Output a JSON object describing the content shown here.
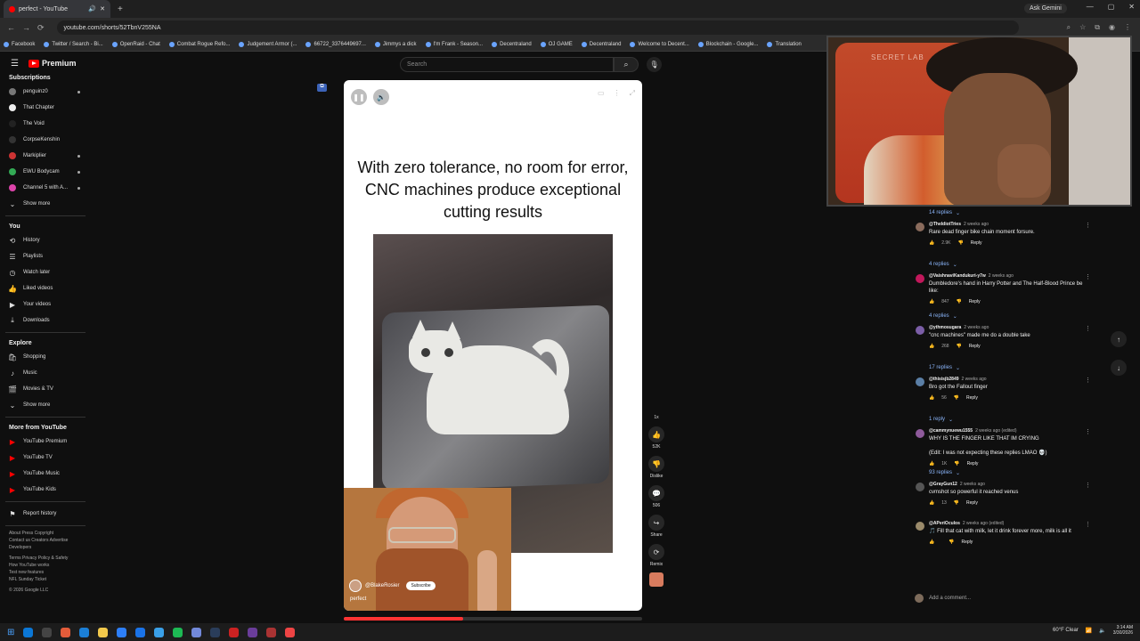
{
  "browser": {
    "tab_title": "perfect - YouTube",
    "new_tab": "+",
    "ask_gemini": "Ask Gemini",
    "url": "youtube.com/shorts/52TbnV255NA",
    "window_controls": [
      "—",
      "▢",
      "✕"
    ],
    "bookmarks": [
      "Facebook",
      "Twitter / Search - Bi...",
      "OpenRaid - Chat",
      "Combat Rogue Refo...",
      "Judgement Armor (...",
      "66722_3376449697...",
      "Jimmys a dick",
      "I'm Frank - Season...",
      "Decentraland",
      "OJ GAME",
      "Decentraland",
      "Welcome to Decent...",
      "Blockchain - Google...",
      "Translation"
    ]
  },
  "youtube": {
    "logo_text": "Premium",
    "search_placeholder": "Search"
  },
  "sidebar": {
    "subscriptions_title": "Subscriptions",
    "subscriptions": [
      {
        "label": "penguinz0",
        "color": "#777",
        "dot": true
      },
      {
        "label": "That Chapter",
        "color": "#eee",
        "dot": false
      },
      {
        "label": "The Void",
        "color": "#222",
        "dot": false
      },
      {
        "label": "CorpseKenshin",
        "color": "#333",
        "dot": false
      },
      {
        "label": "Markiplier",
        "color": "#c33",
        "dot": true
      },
      {
        "label": "EWU Bodycam",
        "color": "#3a5",
        "dot": true
      },
      {
        "label": "Channel 5 with A...",
        "color": "#d4a",
        "dot": true
      }
    ],
    "show_more_1": "Show more",
    "you_title": "You",
    "you_items": [
      {
        "label": "History",
        "icon": "⟲"
      },
      {
        "label": "Playlists",
        "icon": "☰"
      },
      {
        "label": "Watch later",
        "icon": "◷"
      },
      {
        "label": "Liked videos",
        "icon": "👍"
      },
      {
        "label": "Your videos",
        "icon": "▶"
      },
      {
        "label": "Downloads",
        "icon": "⤓"
      }
    ],
    "explore_title": "Explore",
    "explore_items": [
      {
        "label": "Shopping",
        "icon": "🛍"
      },
      {
        "label": "Music",
        "icon": "♪"
      },
      {
        "label": "Movies & TV",
        "icon": "🎬"
      }
    ],
    "show_more_2": "Show more",
    "more_title": "More from YouTube",
    "more_items": [
      "YouTube Premium",
      "YouTube TV",
      "YouTube Music",
      "YouTube Kids"
    ],
    "report_history": "Report history",
    "footer": [
      "About  Press  Copyright",
      "Contact us  Creators  Advertise",
      "Developers",
      "",
      "Terms  Privacy  Policy & Safety",
      "How YouTube works",
      "Test new features",
      "NFL Sunday Ticket",
      "",
      "© 2026 Google LLC"
    ]
  },
  "short": {
    "caption": "With zero tolerance, no room for error, CNC machines produce exceptional cutting results",
    "channel": "@BlakeRosier",
    "subscribe": "Subscribe",
    "title": "perfect",
    "progress": 0.4,
    "actions": {
      "speed": "1x",
      "like_count": "52K",
      "dislike_label": "Dislike",
      "comment_count": "506",
      "share_label": "Share",
      "remix_label": "Remix"
    }
  },
  "webcam": {
    "chair_brand": "SECRET LAB"
  },
  "comments": {
    "top_replies": "14 replies",
    "items": [
      {
        "user": "@TheIdiotTries",
        "time": "2 weeks ago",
        "text": "Rare dead finger bike chain moment forsure.",
        "likes": "2.9K",
        "replies": "4 replies",
        "avatar": "#8a6b5c"
      },
      {
        "user": "@VaishnaviKandukuri-y7w",
        "time": "2 weeks ago",
        "text": "Dumbledore's hand in Harry Potter and The Half-Blood Prince be like:",
        "likes": "847",
        "replies": "4 replies",
        "avatar": "#c2185b"
      },
      {
        "user": "@ythmosugara",
        "time": "2 weeks ago",
        "text": "\"cnc machines\" made me do a double take",
        "likes": "268",
        "replies": "17 replies",
        "avatar": "#7b5ea7"
      },
      {
        "user": "@thisisjb2849",
        "time": "2 weeks ago",
        "text": "Bro got the Fallout finger",
        "likes": "56",
        "replies": "1 reply",
        "avatar": "#5b7fa6"
      },
      {
        "user": "@cammynuewu1555",
        "time": "2 weeks ago (edited)",
        "text": "WHY IS THE FINGER LIKE THAT IM CRYING\n\n(Edit: I was not expecting these replies LMAO 💀)",
        "likes": "1K",
        "replies": "93 replies",
        "avatar": "#8e5a9b"
      },
      {
        "user": "@GrayGun12",
        "time": "2 weeks ago",
        "text": "cvmshot so powerful it reached venus",
        "likes": "13",
        "replies": "",
        "avatar": "#555"
      },
      {
        "user": "@APeriOculos",
        "time": "2 weeks ago (edited)",
        "text": "🎵 Fill that cat with milk, let it drink forever more, milk is all it",
        "likes": "",
        "replies": "",
        "avatar": "#9a8a6a"
      }
    ],
    "reply_label": "Reply",
    "add_comment": "Add a comment..."
  },
  "taskbar": {
    "weather": "60°F  Clear",
    "time": "3:14 AM",
    "date": "3/30/2026",
    "icons": [
      "#0b77d6",
      "#444",
      "#e45c3a",
      "#1b7fd6",
      "#f2c94c",
      "#2d7ff9",
      "#1a73e8",
      "#3aa0e8",
      "#1db954",
      "#7289da",
      "#2a3d5a",
      "#c22",
      "#6a3d9a",
      "#a33",
      "#e44"
    ]
  }
}
